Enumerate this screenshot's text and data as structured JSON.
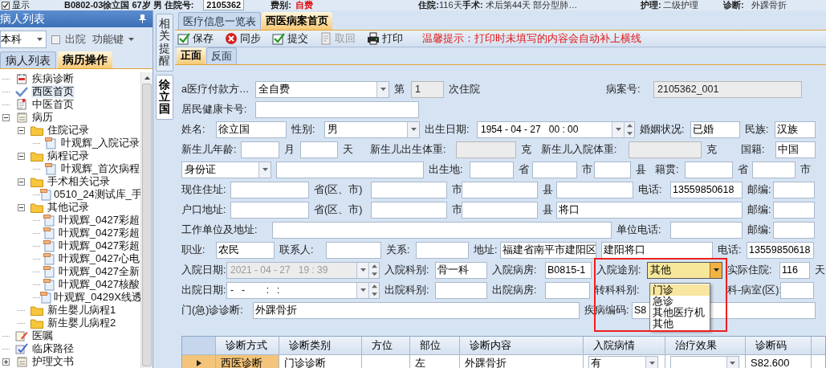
{
  "header": [
    {
      "kind": "check",
      "text": "显示",
      "checked": true
    },
    {
      "kind": "bold",
      "text": "B0802-03"
    },
    {
      "kind": "bold",
      "text": "徐立国 67岁 男 住院号:"
    },
    {
      "kind": "box",
      "text": "2105362"
    },
    {
      "kind": "bold",
      "text": "费别:"
    },
    {
      "kind": "alert",
      "text": "自费"
    },
    {
      "kind": "bold",
      "text": "住院:"
    },
    {
      "kind": "plain",
      "text": "116天"
    },
    {
      "kind": "bold",
      "text": "手术:"
    },
    {
      "kind": "plain",
      "text": "术后第44天 部分型肺…"
    },
    {
      "kind": "bold",
      "text": "护理:"
    },
    {
      "kind": "plain",
      "text": "二级护理"
    },
    {
      "kind": "bold",
      "text": "诊断:"
    },
    {
      "kind": "plain",
      "text": "外踝骨折"
    }
  ],
  "left_panel": {
    "title": "病人列表",
    "dept_select": "本科",
    "discharged": {
      "label": "出院",
      "checked": false
    },
    "function_menu": "功能键",
    "tabs": [
      {
        "label": "病人列表",
        "selected": false
      },
      {
        "label": "病历操作",
        "selected": true
      }
    ],
    "tree": [
      {
        "label": "疾病诊断",
        "kind": "calendar",
        "selected": false
      },
      {
        "label": "西医首页",
        "kind": "check",
        "selected": true
      },
      {
        "label": "中医首页",
        "kind": "doc",
        "selected": false
      },
      {
        "label": "病历",
        "kind": "notepad",
        "selected": false,
        "expanded": true,
        "children": [
          {
            "label": "住院记录",
            "kind": "folder",
            "selected": false,
            "expanded": true,
            "children": [
              {
                "label": "叶观辉_入院记录",
                "kind": "file",
                "selected": false
              }
            ]
          },
          {
            "label": "病程记录",
            "kind": "folder",
            "selected": false,
            "expanded": true,
            "children": [
              {
                "label": "叶观辉_首次病程",
                "kind": "file",
                "selected": false
              }
            ]
          },
          {
            "label": "手术相关记录",
            "kind": "folder",
            "selected": false,
            "expanded": true,
            "children": [
              {
                "label": "0510_24测试库_手",
                "kind": "file",
                "selected": false
              }
            ]
          },
          {
            "label": "其他记录",
            "kind": "folder",
            "selected": false,
            "expanded": true,
            "children": [
              {
                "label": "叶观辉_0427彩超",
                "kind": "file",
                "selected": false
              },
              {
                "label": "叶观辉_0427彩超",
                "kind": "file",
                "selected": false
              },
              {
                "label": "叶观辉_0427彩超",
                "kind": "file",
                "selected": false
              },
              {
                "label": "叶观辉_0427心电",
                "kind": "file",
                "selected": false
              },
              {
                "label": "叶观辉_0427全新",
                "kind": "file",
                "selected": false
              },
              {
                "label": "叶观辉_0427核酸",
                "kind": "file",
                "selected": false
              },
              {
                "label": "叶观辉_0429X线透",
                "kind": "file",
                "selected": false
              }
            ]
          },
          {
            "label": "新生婴儿病程1",
            "kind": "folder",
            "selected": false
          },
          {
            "label": "新生婴儿病程2",
            "kind": "folder",
            "selected": false
          }
        ]
      },
      {
        "label": "医嘱",
        "kind": "pencil",
        "selected": false
      },
      {
        "label": "临床路径",
        "kind": "path",
        "selected": false
      },
      {
        "label": "护理文书",
        "kind": "notepad",
        "selected": false,
        "expanded": false
      }
    ]
  },
  "side_tabs": [
    {
      "label": "相关提醒",
      "selected": false
    },
    {
      "label": "徐立国",
      "selected": true
    }
  ],
  "main": {
    "tabs": [
      {
        "label": "医疗信息一览表",
        "selected": false
      },
      {
        "label": "西医病案首页",
        "selected": true
      }
    ],
    "toolbar": [
      {
        "label": "保存",
        "kind": "save",
        "disabled": false
      },
      {
        "label": "同步",
        "kind": "sync",
        "disabled": false
      },
      {
        "label": "提交",
        "kind": "submit",
        "disabled": false
      },
      {
        "label": "取回",
        "kind": "retrieve",
        "disabled": true
      },
      {
        "label": "打印",
        "kind": "print",
        "disabled": false
      }
    ],
    "notice": "温馨提示：打印时未填写的内容会自动补上横线",
    "sub_tabs": [
      {
        "label": "正面",
        "selected": true
      },
      {
        "label": "反面",
        "selected": false
      }
    ],
    "form": [
      [
        {
          "kind": "label",
          "text": "a医疗付款方…"
        },
        {
          "kind": "select",
          "value": "全自费"
        },
        {
          "kind": "label",
          "text": "第"
        },
        {
          "kind": "readonly",
          "value": "1"
        },
        {
          "kind": "label",
          "text": "次住院"
        },
        {
          "kind": "label",
          "text": "病案号:"
        },
        {
          "kind": "readonly",
          "value": "2105362_001"
        }
      ],
      [
        {
          "kind": "label",
          "text": "居民健康卡号:"
        },
        {
          "kind": "input"
        }
      ],
      [
        {
          "kind": "label",
          "text": "姓名:"
        },
        {
          "kind": "input",
          "value": "徐立国"
        },
        {
          "kind": "label",
          "text": "性别:"
        },
        {
          "kind": "select",
          "value": "男"
        },
        {
          "kind": "label",
          "text": "出生日期:"
        },
        {
          "kind": "date",
          "value": "1954 - 04 - 27   00 : 00",
          "disabled": false
        },
        {
          "kind": "label",
          "text": "婚姻状况:"
        },
        {
          "kind": "input",
          "value": "已婚"
        },
        {
          "kind": "label",
          "text": "民族:"
        },
        {
          "kind": "input",
          "value": "汉族"
        }
      ],
      [
        {
          "kind": "label",
          "text": "新生儿年龄:"
        },
        {
          "kind": "input"
        },
        {
          "kind": "label",
          "text": "月"
        },
        {
          "kind": "input"
        },
        {
          "kind": "label",
          "text": "天"
        },
        {
          "kind": "label",
          "text": "新生儿出生体重:"
        },
        {
          "kind": "readonly"
        },
        {
          "kind": "label",
          "text": "克"
        },
        {
          "kind": "label",
          "text": "新生儿入院体重:"
        },
        {
          "kind": "readonly"
        },
        {
          "kind": "label",
          "text": "克"
        },
        {
          "kind": "label",
          "text": "国籍:"
        },
        {
          "kind": "input",
          "value": "中国"
        }
      ],
      [
        {
          "kind": "select",
          "value": "身份证"
        },
        {
          "kind": "input"
        },
        {
          "kind": "label",
          "text": "出生地:"
        },
        {
          "kind": "input"
        },
        {
          "kind": "label",
          "text": "省"
        },
        {
          "kind": "input"
        },
        {
          "kind": "label",
          "text": "市"
        },
        {
          "kind": "input"
        },
        {
          "kind": "label",
          "text": "县"
        },
        {
          "kind": "label",
          "text": "籍贯:"
        },
        {
          "kind": "input"
        },
        {
          "kind": "label",
          "text": "省"
        },
        {
          "kind": "input"
        },
        {
          "kind": "label",
          "text": "市"
        }
      ],
      [
        {
          "kind": "label",
          "text": "现住住址:"
        },
        {
          "kind": "input"
        },
        {
          "kind": "label",
          "text": "省(区、市)"
        },
        {
          "kind": "input"
        },
        {
          "kind": "label",
          "text": "市"
        },
        {
          "kind": "input"
        },
        {
          "kind": "label",
          "text": "县"
        },
        {
          "kind": "input"
        },
        {
          "kind": "label",
          "text": "电话:"
        },
        {
          "kind": "input",
          "value": "13559850618"
        },
        {
          "kind": "label",
          "text": "邮编:"
        },
        {
          "kind": "input"
        }
      ],
      [
        {
          "kind": "label",
          "text": "户口地址:"
        },
        {
          "kind": "input"
        },
        {
          "kind": "label",
          "text": "省(区、市)"
        },
        {
          "kind": "input"
        },
        {
          "kind": "label",
          "text": "市"
        },
        {
          "kind": "input"
        },
        {
          "kind": "label",
          "text": "县"
        },
        {
          "kind": "input",
          "value": "将口"
        },
        {
          "kind": "label",
          "text": "邮编:"
        },
        {
          "kind": "input"
        }
      ],
      [
        {
          "kind": "label",
          "text": "工作单位及地址:"
        },
        {
          "kind": "input"
        },
        {
          "kind": "label",
          "text": "单位电话:"
        },
        {
          "kind": "input"
        },
        {
          "kind": "label",
          "text": "邮编:"
        },
        {
          "kind": "input"
        }
      ],
      [
        {
          "kind": "label",
          "text": "职业:"
        },
        {
          "kind": "input",
          "value": "农民"
        },
        {
          "kind": "label",
          "text": "联系人:"
        },
        {
          "kind": "input"
        },
        {
          "kind": "label",
          "text": "关系:"
        },
        {
          "kind": "input"
        },
        {
          "kind": "label",
          "text": "地址:"
        },
        {
          "kind": "input",
          "value": "福建省南平市建阳区"
        },
        {
          "kind": "input",
          "value": "建阳将口"
        },
        {
          "kind": "label",
          "text": "电话:"
        },
        {
          "kind": "input",
          "value": "13559850618"
        }
      ],
      [
        {
          "kind": "label",
          "text": "入院日期:"
        },
        {
          "kind": "date",
          "value": "2021 - 04 - 27   19 : 39",
          "disabled": true
        },
        {
          "kind": "label",
          "text": "入院科别:"
        },
        {
          "kind": "input",
          "value": "骨一科"
        },
        {
          "kind": "label",
          "text": "入院病房:"
        },
        {
          "kind": "input",
          "value": "B0815-1"
        },
        {
          "kind": "label",
          "text": "入院途别:"
        },
        {
          "kind": "select",
          "value": "其他",
          "focused": true
        },
        {
          "kind": "label",
          "text": "实际住院:"
        },
        {
          "kind": "input",
          "value": "116"
        },
        {
          "kind": "label",
          "text": "天"
        }
      ],
      [
        {
          "kind": "label",
          "text": "出院日期:"
        },
        {
          "kind": "date",
          "value": "-   -        :   :",
          "disabled": false
        },
        {
          "kind": "label",
          "text": "出院科别:"
        },
        {
          "kind": "input"
        },
        {
          "kind": "label",
          "text": "出院病房:"
        },
        {
          "kind": "input"
        },
        {
          "kind": "label",
          "text": "转科科别:"
        },
        {
          "kind": "label",
          "text": "科-病室(区):"
        },
        {
          "kind": "input"
        }
      ],
      [
        {
          "kind": "label",
          "text": "门(急)诊诊断:"
        },
        {
          "kind": "input",
          "value": "外踝骨折"
        },
        {
          "kind": "label",
          "text": "疾病编码:"
        },
        {
          "kind": "input",
          "value": "S8"
        }
      ]
    ],
    "dropdown": [
      {
        "label": "门诊",
        "selected": true
      },
      {
        "label": "急诊",
        "selected": false
      },
      {
        "label": "其他医疗机",
        "selected": false
      },
      {
        "label": "其他",
        "selected": false
      }
    ],
    "table": {
      "columns": [
        "诊断方式",
        "诊断类别",
        "方位",
        "部位",
        "诊断内容",
        "入院病情",
        "治疗效果",
        "诊断码"
      ],
      "rows": [
        {
          "selected": true,
          "cells": [
            "西医诊断",
            "门诊诊断",
            "",
            "左",
            "外踝骨折",
            "有",
            "",
            "S82.600"
          ]
        }
      ]
    }
  }
}
